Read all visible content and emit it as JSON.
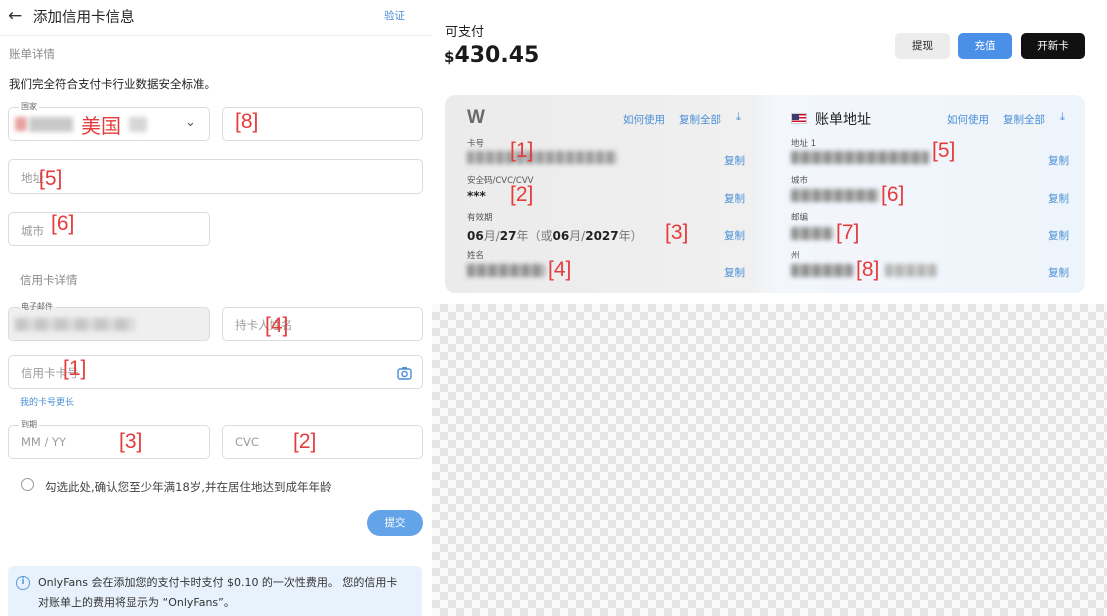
{
  "left": {
    "header": {
      "back_icon": "arrow-left-icon",
      "title": "添加信用卡信息",
      "verify": "验证"
    },
    "billing": {
      "section_title": "账单详情",
      "security_text": "我们完全符合支付卡行业数据安全标准。",
      "country_label": "国家",
      "country_value": "美国",
      "country_marker": "[8]",
      "address_placeholder": "地址",
      "address_marker": "[5]",
      "city_placeholder": "城市",
      "city_marker": "[6]"
    },
    "card": {
      "section_title": "信用卡详情",
      "email_label": "电子邮件",
      "holder_placeholder": "持卡人姓名",
      "holder_marker": "[4]",
      "number_placeholder": "信用卡卡号",
      "number_marker": "[1]",
      "longer_number_link": "我的卡号更长",
      "expiry_label": "到期",
      "expiry_placeholder": "MM / YY",
      "expiry_marker": "[3]",
      "cvc_placeholder": "CVC",
      "cvc_marker": "[2]"
    },
    "age_confirm": "勾选此处,确认您至少年满18岁,并在居住地达到成年年龄",
    "submit": "提交",
    "info": {
      "line1": "OnlyFans 会在添加您的支付卡时支付 $0.10 的一次性费用。 您的信用卡",
      "line2": "对账单上的费用将显示为 “OnlyFans”。"
    }
  },
  "right": {
    "available_label": "可支付",
    "currency": "$",
    "available_amount": "430.45",
    "buttons": {
      "withdraw": "提现",
      "recharge": "充值",
      "new_card": "开新卡"
    },
    "card_panel": {
      "logo": "W",
      "how_to_use": "如何使用",
      "copy_all": "复制全部",
      "download_icon": "download-icon",
      "copy": "复制",
      "number_label": "卡号",
      "number_marker": "[1]",
      "cvv_label": "安全码/CVC/CVV",
      "cvv_value": "***",
      "cvv_marker": "[2]",
      "expiry_label": "有效期",
      "exp_m": "06",
      "exp_month_unit": "月/",
      "exp_y2": "27",
      "exp_year_unit_open": "年（或",
      "exp_m_b": "06",
      "exp_month_unit_b": "月/",
      "exp_y4": "2027",
      "exp_year_unit_close": "年）",
      "expiry_marker": "[3]",
      "name_label": "姓名",
      "name_marker": "[4]"
    },
    "address_panel": {
      "flag_icon": "us-flag-icon",
      "title": "账单地址",
      "how_to_use": "如何使用",
      "copy_all": "复制全部",
      "download_icon": "download-icon",
      "copy": "复制",
      "addr1_label": "地址 1",
      "addr1_marker": "[5]",
      "city_label": "城市",
      "city_marker": "[6]",
      "zip_label": "邮编",
      "zip_marker": "[7]",
      "state_label": "州",
      "state_marker": "[8]"
    }
  }
}
